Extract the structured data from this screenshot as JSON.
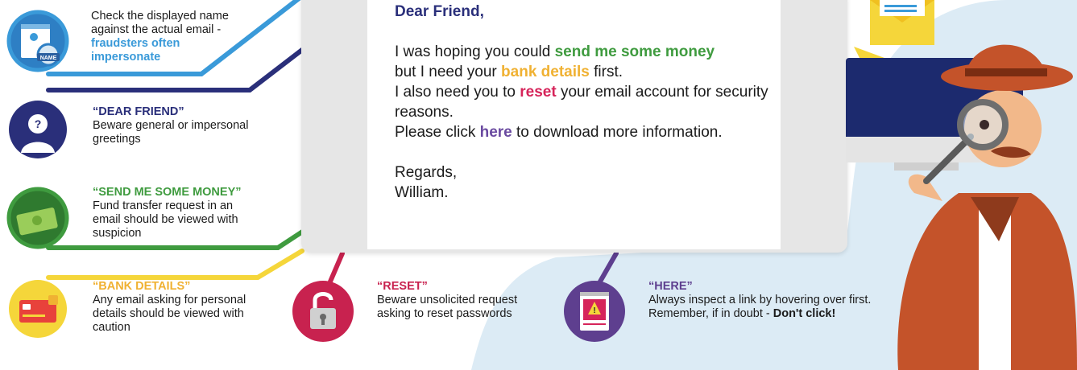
{
  "tips": {
    "name": {
      "line1": "Check the displayed name",
      "line2": "against the actual email -",
      "highlight": "fraudsters often impersonate",
      "icon_label": "NAME"
    },
    "dear_friend": {
      "heading": "“DEAR FRIEND”",
      "body": "Beware general or impersonal greetings"
    },
    "money": {
      "heading": "“SEND ME SOME MONEY”",
      "body": "Fund transfer request in an email should be viewed with suspicion"
    },
    "bank": {
      "heading": "“BANK DETAILS”",
      "body": "Any email asking for personal details should be viewed with caution"
    },
    "reset": {
      "heading": "“RESET”",
      "body": "Beware unsolicited request asking to reset passwords"
    },
    "here": {
      "heading": "“HERE”",
      "body": "Always inspect a link by hovering over first. Remember, if in doubt - ",
      "emphasis": "Don't click!"
    }
  },
  "email": {
    "greeting": "Dear Friend,",
    "l1_pre": "I was hoping you could ",
    "l1_hl": "send me some money",
    "l2_pre": "but I need your ",
    "l2_hl": "bank details",
    "l2_post": " first.",
    "l3_pre": "I also need you to ",
    "l3_hl": "reset",
    "l3_post": " your email account for security reasons.",
    "l4_pre": "Please click ",
    "l4_hl": "here",
    "l4_post": " to download more information.",
    "closing": "Regards,",
    "signature": "William."
  },
  "colors": {
    "blue": "#3a9ad9",
    "navy": "#2a2f7a",
    "green": "#3f9b3f",
    "yellow": "#f5d63a",
    "red": "#c8224f",
    "purple": "#5e3f8f",
    "light_blue_bg": "#dcebf5"
  },
  "icons": [
    "name-card-icon",
    "anonymous-person-icon",
    "cash-icon",
    "credit-card-icon",
    "unlocked-padlock-icon",
    "warning-document-icon",
    "envelope-icon",
    "paper-plane-icon",
    "monitor-icon",
    "detective-icon",
    "magnifying-glass-icon"
  ]
}
